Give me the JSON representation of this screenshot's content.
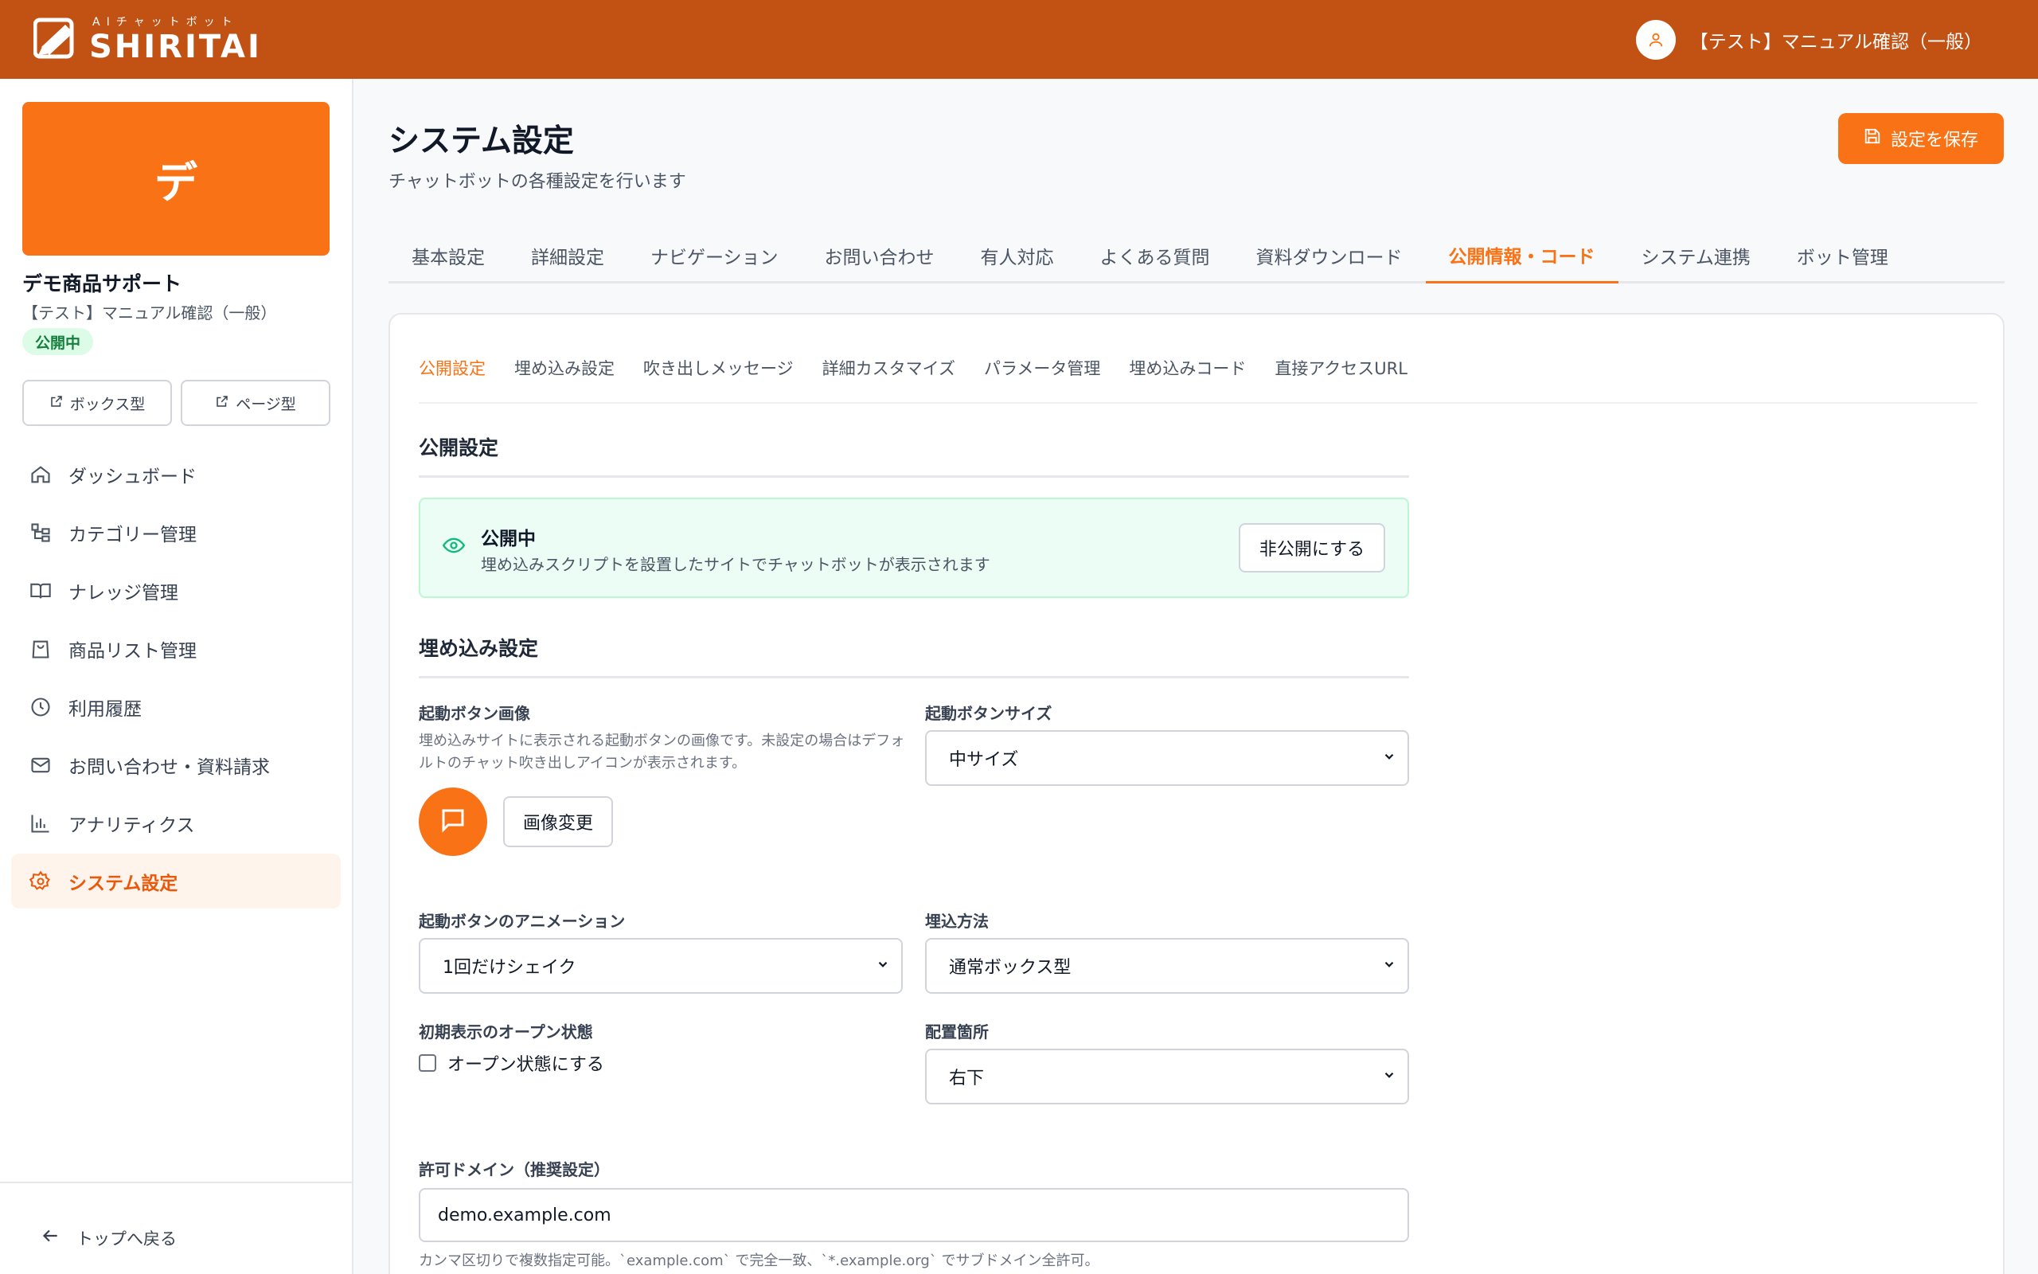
{
  "header": {
    "logo_sub": "AIチャットボット",
    "logo_main": "SHIRITAI",
    "user_name": "【テスト】マニュアル確認（一般）"
  },
  "sidebar": {
    "bot_initial": "デ",
    "bot_name": "デモ商品サポート",
    "bot_org": "【テスト】マニュアル確認（一般）",
    "status": "公開中",
    "box_button": "ボックス型",
    "page_button": "ページ型",
    "nav": [
      {
        "label": "ダッシュボード",
        "icon": "home-icon"
      },
      {
        "label": "カテゴリー管理",
        "icon": "category-tree-icon"
      },
      {
        "label": "ナレッジ管理",
        "icon": "book-icon"
      },
      {
        "label": "商品リスト管理",
        "icon": "shopping-bag-icon"
      },
      {
        "label": "利用履歴",
        "icon": "clock-icon"
      },
      {
        "label": "お問い合わせ・資料請求",
        "icon": "mail-icon"
      },
      {
        "label": "アナリティクス",
        "icon": "bar-chart-icon"
      },
      {
        "label": "システム設定",
        "icon": "gear-icon",
        "active": true
      }
    ],
    "back_label": "トップへ戻る"
  },
  "main": {
    "title": "システム設定",
    "subtitle": "チャットボットの各種設定を行います",
    "save_label": "設定を保存",
    "tabs": [
      "基本設定",
      "詳細設定",
      "ナビゲーション",
      "お問い合わせ",
      "有人対応",
      "よくある質問",
      "資料ダウンロード",
      "公開情報・コード",
      "システム連携",
      "ボット管理"
    ],
    "active_tab": "公開情報・コード",
    "subtabs": [
      "公開設定",
      "埋め込み設定",
      "吹き出しメッセージ",
      "詳細カスタマイズ",
      "パラメータ管理",
      "埋め込みコード",
      "直接アクセスURL"
    ],
    "active_subtab": "公開設定"
  },
  "publish": {
    "section_title": "公開設定",
    "status_title": "公開中",
    "status_text": "埋め込みスクリプトを設置したサイトでチャットボットが表示されます",
    "unpublish_label": "非公開にする"
  },
  "embed": {
    "section_title": "埋め込み設定",
    "button_image_label": "起動ボタン画像",
    "button_image_help": "埋め込みサイトに表示される起動ボタンの画像です。未設定の場合はデフォルトのチャット吹き出しアイコンが表示されます。",
    "change_image_label": "画像変更",
    "button_size_label": "起動ボタンサイズ",
    "button_size_value": "中サイズ",
    "animation_label": "起動ボタンのアニメーション",
    "animation_value": "1回だけシェイク",
    "embed_method_label": "埋込方法",
    "embed_method_value": "通常ボックス型",
    "initial_open_label": "初期表示のオープン状態",
    "initial_open_checkbox": "オープン状態にする",
    "position_label": "配置箇所",
    "position_value": "右下",
    "domain_label": "許可ドメイン（推奨設定）",
    "domain_value": "demo.example.com",
    "domain_help": "カンマ区切りで複数指定可能。`example.com` で完全一致、`*.example.org` でサブドメイン全許可。"
  },
  "colors": {
    "header": "#c25114",
    "accent": "#f97316",
    "success_bg": "#ecfdf5",
    "success_text": "#15803d"
  }
}
